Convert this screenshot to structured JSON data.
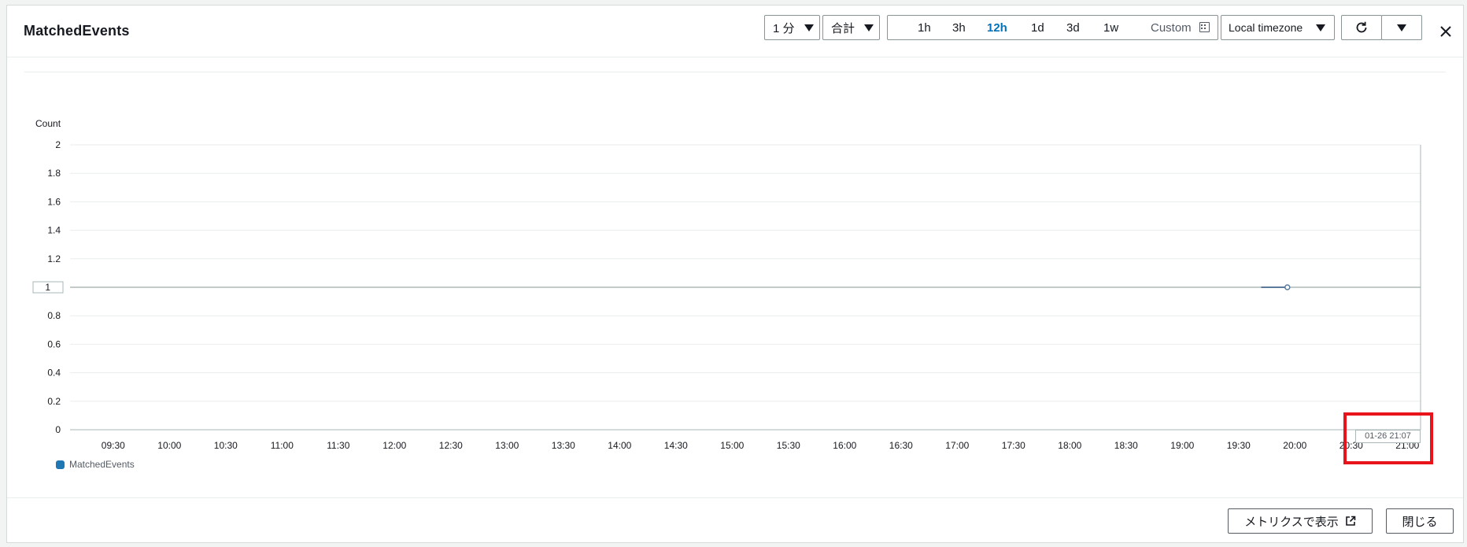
{
  "header": {
    "title": "MatchedEvents",
    "period": "1 分",
    "statistic": "合計",
    "ranges": [
      "1h",
      "3h",
      "12h",
      "1d",
      "3d",
      "1w"
    ],
    "active_range": "12h",
    "custom_label": "Custom",
    "timezone": "Local timezone"
  },
  "footer": {
    "view_in_metrics": "メトリクスで表示",
    "close": "閉じる"
  },
  "colors": {
    "series": "#1f77b4",
    "line": "#5b7a9c",
    "highlight": "#e8131b",
    "accent": "#0073bb"
  },
  "chart_data": {
    "type": "line",
    "ylabel": "Count",
    "y_ticks": [
      "2",
      "1.8",
      "1.6",
      "1.4",
      "1.2",
      "1",
      "0.8",
      "0.6",
      "0.4",
      "0.2",
      "0"
    ],
    "ylim": [
      0,
      2
    ],
    "highlighted_y_tick": "1",
    "x_ticks": [
      "09:30",
      "10:00",
      "10:30",
      "11:00",
      "11:30",
      "12:00",
      "12:30",
      "13:00",
      "13:30",
      "14:00",
      "14:30",
      "15:00",
      "15:30",
      "16:00",
      "16:30",
      "17:00",
      "17:30",
      "18:00",
      "18:30",
      "19:00",
      "19:30",
      "20:00",
      "20:30",
      "21:00"
    ],
    "xlim": [
      "09:07",
      "21:07"
    ],
    "series": [
      {
        "name": "MatchedEvents",
        "points": [
          {
            "x": "19:42",
            "y": 1
          },
          {
            "x": "19:56",
            "y": 1
          }
        ]
      }
    ],
    "reference_line": {
      "y": 1
    },
    "cursor": {
      "x": "21:07",
      "label": "01-26 21:07"
    },
    "grid": true,
    "legend": "bottom-left"
  }
}
